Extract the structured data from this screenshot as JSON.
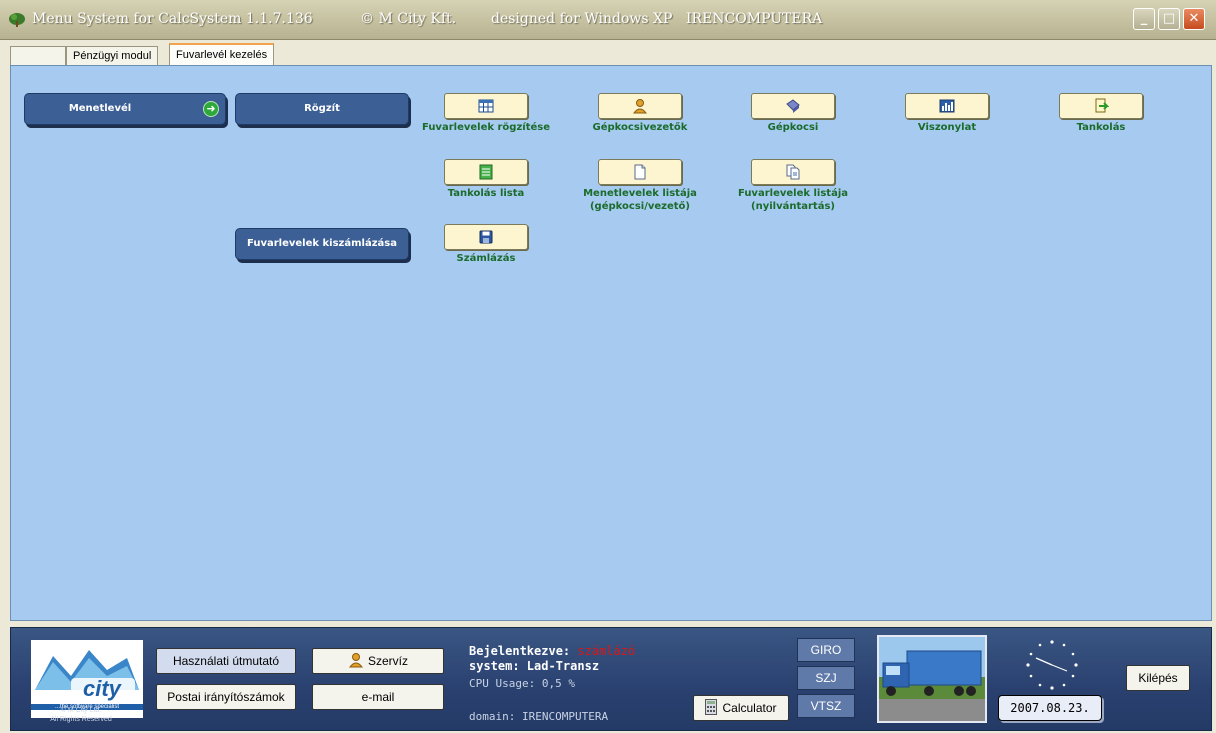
{
  "window": {
    "app_title": "Menu System for CalcSystem 1.1.7.136",
    "copyright": "© M City Kft.",
    "designed_for": "designed for Windows XP",
    "computer": "IRENCOMPUTERA",
    "minimize": "_",
    "maximize": "□",
    "close": "✕"
  },
  "tabs": [
    {
      "label": ""
    },
    {
      "label": "Pénzügyi modul"
    },
    {
      "label": "Fuvarlevél kezelés",
      "active": true
    }
  ],
  "menu": {
    "menetlevel": "Menetlevél",
    "rogzit": "Rögzít",
    "kiszamlazas": "Fuvarlevelek kiszámlázása"
  },
  "tools": [
    {
      "label": "Fuvarlevelek rögzítése",
      "icon": "table-icon"
    },
    {
      "label": "Gépkocsivezetők",
      "icon": "driver-icon"
    },
    {
      "label": "Gépkocsi",
      "icon": "car-icon"
    },
    {
      "label": "Viszonylat",
      "icon": "chart-icon"
    },
    {
      "label": "Tankolás",
      "icon": "fuel-icon"
    },
    {
      "label": "Tankolás lista",
      "icon": "list-icon"
    },
    {
      "label": "Menetlevelek listája\n(gépkocsi/vezető)",
      "icon": "document-icon"
    },
    {
      "label": "Fuvarlevelek listája\n(nyilvántartás)",
      "icon": "documents-icon"
    },
    {
      "label": "Számlázás",
      "icon": "save-icon"
    }
  ],
  "footer": {
    "logo_caption_1": "© M City Ltd.",
    "logo_caption_2": "All Rights Reserved",
    "logo_text": "city",
    "logo_tagline": "...the software specialist",
    "manual": "Használati útmutató",
    "postcodes": "Postai irányítószámok",
    "service": "Szervíz",
    "email": "e-mail",
    "login_label": "Bejelentkezve:",
    "login_user": "számlázó",
    "system": "system: Lad-Transz",
    "cpu": "CPU Usage: 0,5 %",
    "domain": "domain: IRENCOMPUTERA",
    "calculator": "Calculator",
    "giro": "GIRO",
    "szj": "SZJ",
    "vtsz": "VTSZ",
    "date": "2007.08.23.",
    "exit": "Kilépés"
  }
}
